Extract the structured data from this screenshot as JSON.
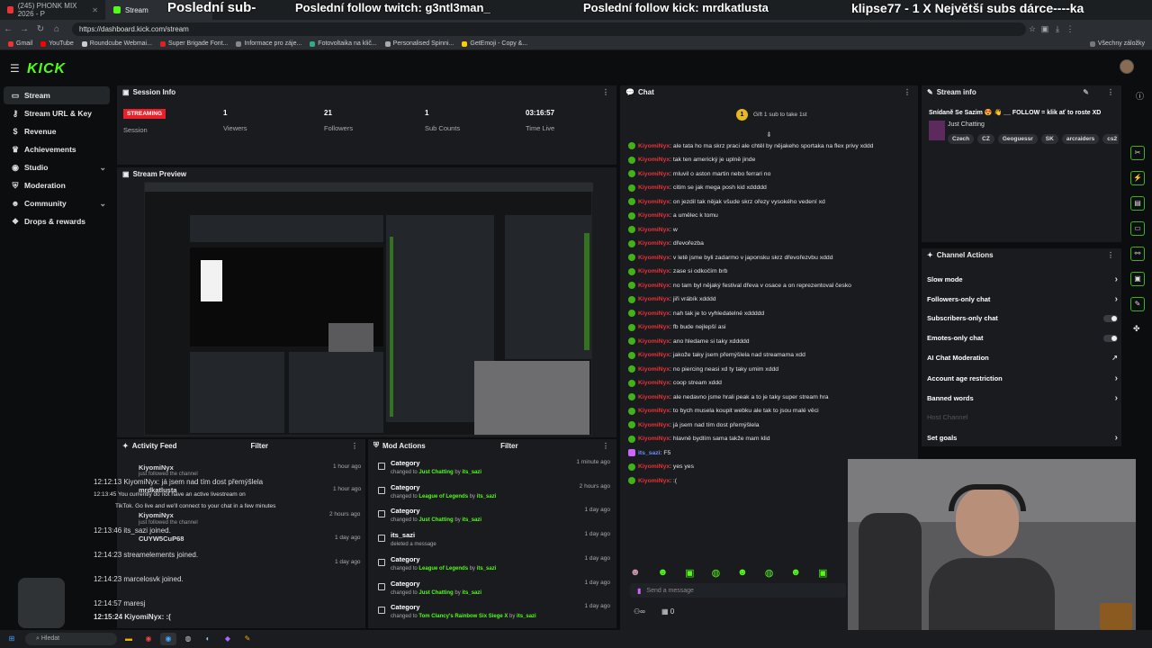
{
  "browser": {
    "tabs": [
      {
        "label": "(245) PHONK MIX 2026 - P"
      },
      {
        "label": "Stream"
      }
    ],
    "url": "https://dashboard.kick.com/stream",
    "bookmarks": [
      "Gmail",
      "YouTube",
      "Roundcube Webmai...",
      "Super Brigade Font...",
      "Informace pro záje...",
      "Fotovoltaika na klič...",
      "Personalised Spinni...",
      "GetEmoji - Copy &..."
    ],
    "bookmarks_right": "Všechny záložky"
  },
  "overlay": {
    "sub_text": "Poslední sub-",
    "twitch_follow": "Poslední follow twitch: g3ntl3man_",
    "kick_follow": "Poslední follow kick: mrdkatlusta",
    "top_donor": "klipse77 - 1 X    Největší subs dárce----ka"
  },
  "app": {
    "logo": "KICK"
  },
  "sidebar": {
    "items": [
      {
        "label": "Stream",
        "icon": "video-icon"
      },
      {
        "label": "Stream URL & Key",
        "icon": "key-icon"
      },
      {
        "label": "Revenue",
        "icon": "money-icon"
      },
      {
        "label": "Achievements",
        "icon": "trophy-icon"
      },
      {
        "label": "Studio",
        "icon": "studio-icon"
      },
      {
        "label": "Moderation",
        "icon": "shield-icon"
      },
      {
        "label": "Community",
        "icon": "people-icon"
      },
      {
        "label": "Drops & rewards",
        "icon": "gift-icon"
      }
    ]
  },
  "session": {
    "title": "Session Info",
    "status": "STREAMING",
    "session_label": "Session",
    "viewers": {
      "value": "1",
      "label": "Viewers"
    },
    "followers": {
      "value": "21",
      "label": "Followers"
    },
    "subs": {
      "value": "1",
      "label": "Sub Counts"
    },
    "time": {
      "value": "03:16:57",
      "label": "Time Live"
    }
  },
  "preview": {
    "title": "Stream Preview"
  },
  "activity": {
    "title": "Activity Feed",
    "filter": "Filter",
    "rows": [
      {
        "text": "KiyomiNyx",
        "time": "1 hour ago"
      },
      {
        "text": "just followed the channel",
        "time": ""
      },
      {
        "text": "12:12:13  KiyomiNyx: já jsem nad tím dost přemýšlela",
        "time": ""
      },
      {
        "text": "mrdkatlusta",
        "time": "1 hour ago"
      },
      {
        "text": "12:13:45  You currently do not have an active livestream on",
        "time": ""
      },
      {
        "text": "TikTok. Go live and we'll connect to your chat in a few minutes",
        "time": ""
      },
      {
        "text": "KiyomiNyx",
        "time": "2 hours ago"
      },
      {
        "text": "just followed the channel",
        "time": ""
      },
      {
        "text": "12:13:46  its_sazi joined.",
        "time": ""
      },
      {
        "text": "CUYW5CuP68",
        "time": "1 day ago"
      },
      {
        "text": "12:14:23  streamelements joined.",
        "time": ""
      },
      {
        "text": "12:14:23  marcelosvk joined.",
        "time": "1 day ago"
      },
      {
        "text": "12:14:57  maresj",
        "time": ""
      },
      {
        "text": "12:15:24  KiyomiNyx: :(",
        "time": ""
      }
    ]
  },
  "mod": {
    "title": "Mod Actions",
    "filter": "Filter",
    "rows": [
      {
        "title": "Category",
        "prefix": "changed to ",
        "target": "Just Chatting",
        "by": "its_sazi",
        "time": "1 minute ago"
      },
      {
        "title": "Category",
        "prefix": "changed to ",
        "target": "League of Legends",
        "by": "its_sazi",
        "time": "2 hours ago"
      },
      {
        "title": "Category",
        "prefix": "changed to ",
        "target": "Just Chatting",
        "by": "its_sazi",
        "time": "1 day ago"
      },
      {
        "title": "its_sazi",
        "prefix": "deleted a message",
        "target": "",
        "by": "",
        "time": "1 day ago"
      },
      {
        "title": "Category",
        "prefix": "changed to ",
        "target": "League of Legends",
        "by": "its_sazi",
        "time": "1 day ago"
      },
      {
        "title": "Category",
        "prefix": "changed to ",
        "target": "Just Chatting",
        "by": "its_sazi",
        "time": "1 day ago"
      },
      {
        "title": "Category",
        "prefix": "changed to ",
        "target": "Tom Clancy's Rainbow Six Siege X",
        "by": "its_sazi",
        "time": "1 day ago"
      }
    ]
  },
  "chat": {
    "title": "Chat",
    "gift_text": "Gift 1 sub to take 1st",
    "input_placeholder": "Send a message",
    "points": "0",
    "messages": [
      {
        "user": "KiyomiNyx",
        "text": "ale tata ho ma skrz praci ale chtěl by nějakeho sportaka na flex privy xddd"
      },
      {
        "user": "KiyomiNyx",
        "text": "tak ten americký je uplně jinde"
      },
      {
        "user": "KiyomiNyx",
        "text": "mluvil o aston martin nebo ferrari no"
      },
      {
        "user": "KiyomiNyx",
        "text": "citim se jak mega posh kid xddddd"
      },
      {
        "user": "KiyomiNyx",
        "text": "on jezdil tak nějak všude skrz ořezy vysokého vedení xd"
      },
      {
        "user": "KiyomiNyx",
        "text": "a umělec k tomu"
      },
      {
        "user": "KiyomiNyx",
        "text": "w"
      },
      {
        "user": "KiyomiNyx",
        "text": "dřevořezba"
      },
      {
        "user": "KiyomiNyx",
        "text": "v letě jsme byli zadarmo v japonsku skrz dřevořezvbu xddd"
      },
      {
        "user": "KiyomiNyx",
        "text": "zase si odkočím brb"
      },
      {
        "user": "KiyomiNyx",
        "text": "no tam byl nějaký festival dřeva v osace a on reprezentoval česko"
      },
      {
        "user": "KiyomiNyx",
        "text": "jiři vrábík xdddd"
      },
      {
        "user": "KiyomiNyx",
        "text": "nah tak je to vyhledatelné xddddd"
      },
      {
        "user": "KiyomiNyx",
        "text": "fb bude nejlepší asi"
      },
      {
        "user": "KiyomiNyx",
        "text": "ano hledame si taky xddddd"
      },
      {
        "user": "KiyomiNyx",
        "text": "jakože taky jsem přemýšlela nad streamama xdd"
      },
      {
        "user": "KiyomiNyx",
        "text": "no piercing neasi xd ty taky umim xddd"
      },
      {
        "user": "KiyomiNyx",
        "text": "coop stream xddd"
      },
      {
        "user": "KiyomiNyx",
        "text": "ale nedavno jsme hrali peak a to je taky super stream hra"
      },
      {
        "user": "KiyomiNyx",
        "text": "to bych musela koupit webku ale tak to jsou malé věci"
      },
      {
        "user": "KiyomiNyx",
        "text": "já jsem nad tím dost přemýšlela"
      },
      {
        "user": "KiyomiNyx",
        "text": "hlavně bydlím sama takže mam klid"
      },
      {
        "user": "its_sazi",
        "text": "F5"
      },
      {
        "user": "KiyomiNyx",
        "text": "yes yes"
      },
      {
        "user": "KiyomiNyx",
        "text": ":("
      }
    ]
  },
  "stream_info": {
    "title": "Stream info",
    "stream_title": "Snídaně Se Sazim 😍 👋 __ FOLLOW = klik ať to roste XD",
    "category": "Just Chatting",
    "tags": [
      "Czech",
      "CZ",
      "Geoguessr",
      "SK",
      "arcraiders",
      "cs2"
    ]
  },
  "channel_actions": {
    "title": "Channel Actions",
    "rows": [
      {
        "label": "Slow mode",
        "kind": "chevron"
      },
      {
        "label": "Followers-only chat",
        "kind": "chevron"
      },
      {
        "label": "Subscribers-only chat",
        "kind": "toggle"
      },
      {
        "label": "Emotes-only chat",
        "kind": "toggle"
      },
      {
        "label": "AI Chat Moderation",
        "kind": "external"
      },
      {
        "label": "Account age restriction",
        "kind": "chevron"
      },
      {
        "label": "Banned words",
        "kind": "chevron"
      },
      {
        "label": "Host Channel",
        "kind": "none"
      },
      {
        "label": "Set goals",
        "kind": "chevron"
      }
    ]
  },
  "taskbar": {
    "search": "Hledat"
  },
  "colors": {
    "accent": "#53fc18",
    "live": "#e8202c",
    "chat_user": "#e6323a",
    "panel": "#191b1f"
  }
}
